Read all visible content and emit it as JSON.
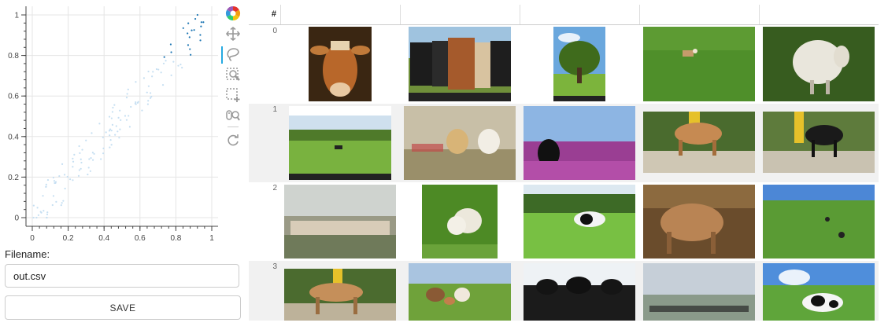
{
  "plot": {
    "x_ticks": [
      "0",
      "0.2",
      "0.4",
      "0.6",
      "0.8",
      "1"
    ],
    "y_ticks": [
      "0",
      "0.2",
      "0.4",
      "0.6",
      "0.8",
      "1"
    ]
  },
  "toolbar": {
    "tools": [
      {
        "name": "bokeh-logo-icon",
        "interactable": false
      },
      {
        "name": "pan-tool-icon",
        "interactable": true
      },
      {
        "name": "lasso-select-tool-icon",
        "interactable": true,
        "active": true
      },
      {
        "name": "box-zoom-tool-icon",
        "interactable": true
      },
      {
        "name": "box-select-tool-icon",
        "interactable": true
      },
      {
        "name": "wheel-zoom-tool-icon",
        "interactable": true
      },
      {
        "name": "reset-tool-icon",
        "interactable": true
      }
    ]
  },
  "export": {
    "filename_label": "Filename:",
    "filename_value": "out.csv",
    "save_label": "SAVE"
  },
  "table": {
    "index_header": "#",
    "row_labels": [
      "0",
      "1",
      "2",
      "3"
    ],
    "rows": [
      [
        "cow-portrait-photo",
        "herd-of-cows-photo",
        "tree-in-field-photo",
        "dog-in-grass-photo",
        "sheep-on-grass-photo"
      ],
      [
        "cows-in-pasture-photo",
        "dogs-running-photo",
        "dog-in-flowers-photo",
        "brown-cow-pen-photo",
        "black-cow-pen-photo"
      ],
      [
        "flock-of-sheep-photo",
        "two-sheep-photo",
        "holstein-cow-field-photo",
        "highland-bull-photo",
        "dogs-in-field-photo"
      ],
      [
        "brown-cow-fence-photo",
        "cows-and-calf-photo",
        "black-cows-closeup-photo",
        "cows-in-fog-photo",
        "holstein-cow-grass-photo"
      ]
    ]
  },
  "colors": {
    "accent": "#26aae1",
    "scatter_light": "#c6dff2",
    "scatter_selected": "#1f77b4"
  }
}
